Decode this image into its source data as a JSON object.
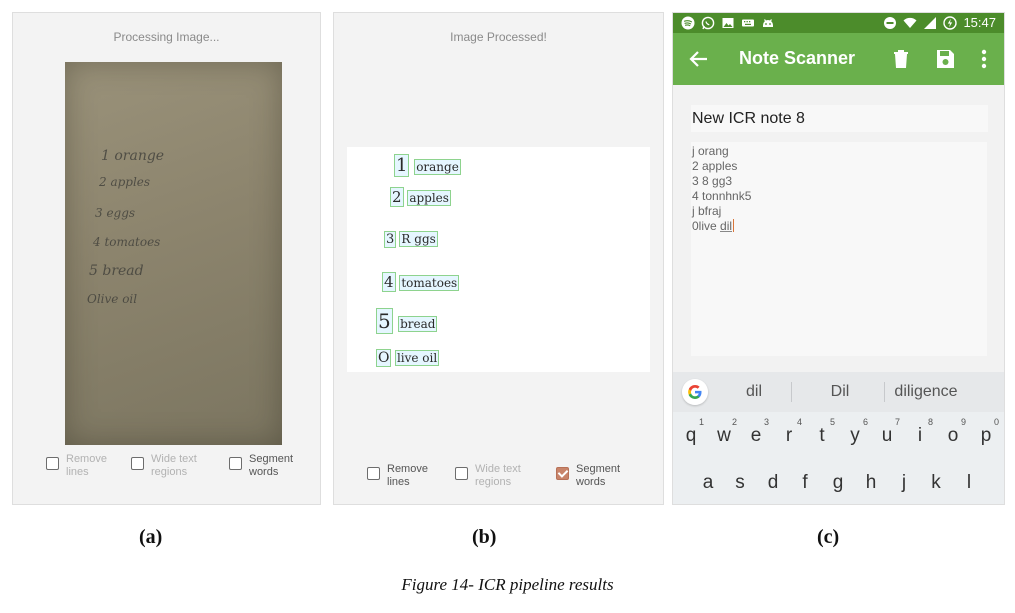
{
  "panel_a": {
    "status": "Processing Image...",
    "handwriting": [
      "1 orange",
      "2 apples",
      "3 eggs",
      "4 tomatoes",
      "5 bread",
      "Olive oil"
    ],
    "options": [
      {
        "label": "Remove\nlines",
        "checked": false
      },
      {
        "label": "Wide text\nregions",
        "checked": false
      },
      {
        "label": "Segment\nwords",
        "checked": false
      }
    ],
    "caption": "(a)"
  },
  "panel_b": {
    "status": "Image Processed!",
    "segmented_lines": [
      {
        "num": "1",
        "word": "orange"
      },
      {
        "num": "2",
        "word": "apples"
      },
      {
        "num": "3",
        "word": "R ggs"
      },
      {
        "num": "4",
        "word": "tomatoes"
      },
      {
        "num": "5",
        "word": "bread"
      },
      {
        "num": "O",
        "word": "live oil"
      }
    ],
    "options": [
      {
        "label": "Remove\nlines",
        "checked": false
      },
      {
        "label": "Wide text\nregions",
        "checked": false
      },
      {
        "label": "Segment\nwords",
        "checked": true
      }
    ],
    "caption": "(b)"
  },
  "panel_c": {
    "status_time": "15:47",
    "app_title": "Note Scanner",
    "note_title": "New ICR note 8",
    "note_lines": [
      "j orang",
      "2 apples",
      "3 8 gg3",
      "4 tonnhnk5",
      "j bfraj"
    ],
    "note_last_prefix": "0live ",
    "note_last_word": "dil",
    "suggestions": [
      "dil",
      "Dil",
      "diligence"
    ],
    "keys_row1": [
      {
        "key": "q",
        "num": "1"
      },
      {
        "key": "w",
        "num": "2"
      },
      {
        "key": "e",
        "num": "3"
      },
      {
        "key": "r",
        "num": "4"
      },
      {
        "key": "t",
        "num": "5"
      },
      {
        "key": "y",
        "num": "6"
      },
      {
        "key": "u",
        "num": "7"
      },
      {
        "key": "i",
        "num": "8"
      },
      {
        "key": "o",
        "num": "9"
      },
      {
        "key": "p",
        "num": "0"
      }
    ],
    "keys_row2": [
      "a",
      "s",
      "d",
      "f",
      "g",
      "h",
      "j",
      "k",
      "l"
    ],
    "caption": "(c)",
    "colors": {
      "statusbar": "#4c8c2b",
      "appbar": "#6ab04c"
    }
  },
  "figure_caption": "Figure 14- ICR pipeline results"
}
